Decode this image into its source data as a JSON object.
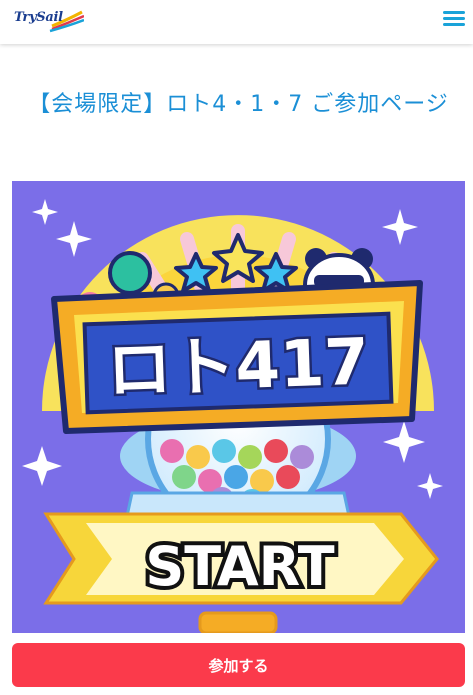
{
  "header": {
    "logo_text": "TrySail",
    "logo_icon": "trysail-logo",
    "menu_icon": "hamburger-menu-icon"
  },
  "main": {
    "title": "【会場限定】ロト4・1・7 ご参加ページ",
    "hero": {
      "logo_text": "ロト417",
      "start_text": "START"
    },
    "join_button_label": "参加する"
  },
  "colors": {
    "title": "#1b8fd6",
    "button": "#fb3a4b",
    "hero_bg": "#7b6ee8",
    "menu": "#1aa3d9"
  }
}
